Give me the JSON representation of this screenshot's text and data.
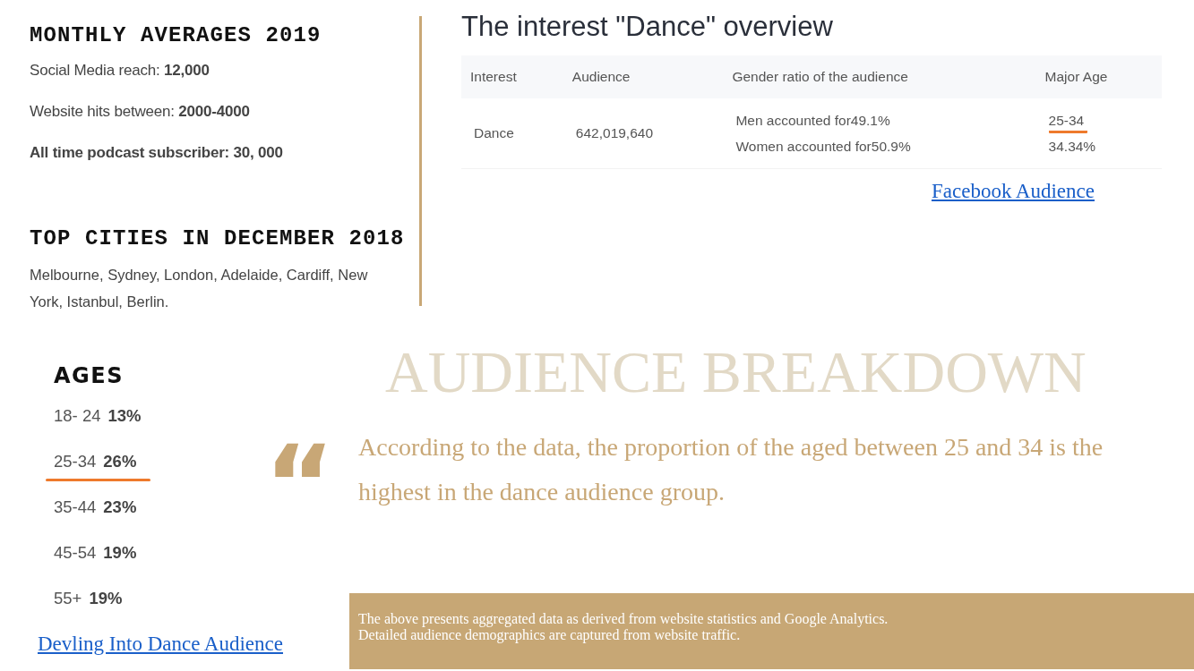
{
  "monthly_averages": {
    "heading": "MONTHLY AVERAGES 2019",
    "stats": [
      {
        "kind": "plain",
        "text": "Social Media reach: **12,000**"
      },
      {
        "kind": "plain",
        "text": "Website hits between: **2000-4000**"
      },
      {
        "kind": "total",
        "text": "All time podcast subscriber:  30, 000"
      }
    ]
  },
  "top_cities": {
    "heading": "TOP CITIES IN DECEMBER 2018",
    "text": "Melbourne, Sydney, London, Adelaide, Cardiff, New York, Istanbul, Berlin."
  },
  "overview": {
    "title": "The interest \"Dance\" overview",
    "table": {
      "columns": [
        "Interest",
        "Audience",
        "Gender ratio of the audience",
        "Major Age"
      ],
      "rows": [
        {
          "interest": "Dance",
          "audience": "642,019,640",
          "gender": [
            "Men accounted for49.1%",
            "Women accounted for50.9%"
          ],
          "major_age": {
            "value": "25-34",
            "highlighted": true,
            "share": "34.34%"
          }
        }
      ]
    },
    "link": "Facebook Audience"
  },
  "ages": {
    "heading": "AGES",
    "items": [
      {
        "range": "18- 24",
        "share": "13%",
        "highlighted": false
      },
      {
        "range": "25-34",
        "share": "26%",
        "highlighted": true
      },
      {
        "range": "35-44",
        "share": "23%",
        "highlighted": false
      },
      {
        "range": "45-54",
        "share": "19%",
        "highlighted": false
      },
      {
        "range": "55+",
        "share": "19%",
        "highlighted": false
      }
    ],
    "link": "Devling Into Dance Audience"
  },
  "breakdown": {
    "title": "AUDIENCE BREAKDOWN",
    "quote_mark": "“",
    "quote": "According to the data, the proportion of the aged between 25 and 34 is the highest in the dance audience group.",
    "note": [
      "The above presents aggregated data as derived from website statistics and Google Analytics.",
      "Detailed audience demographics are captured from website traffic."
    ]
  }
}
